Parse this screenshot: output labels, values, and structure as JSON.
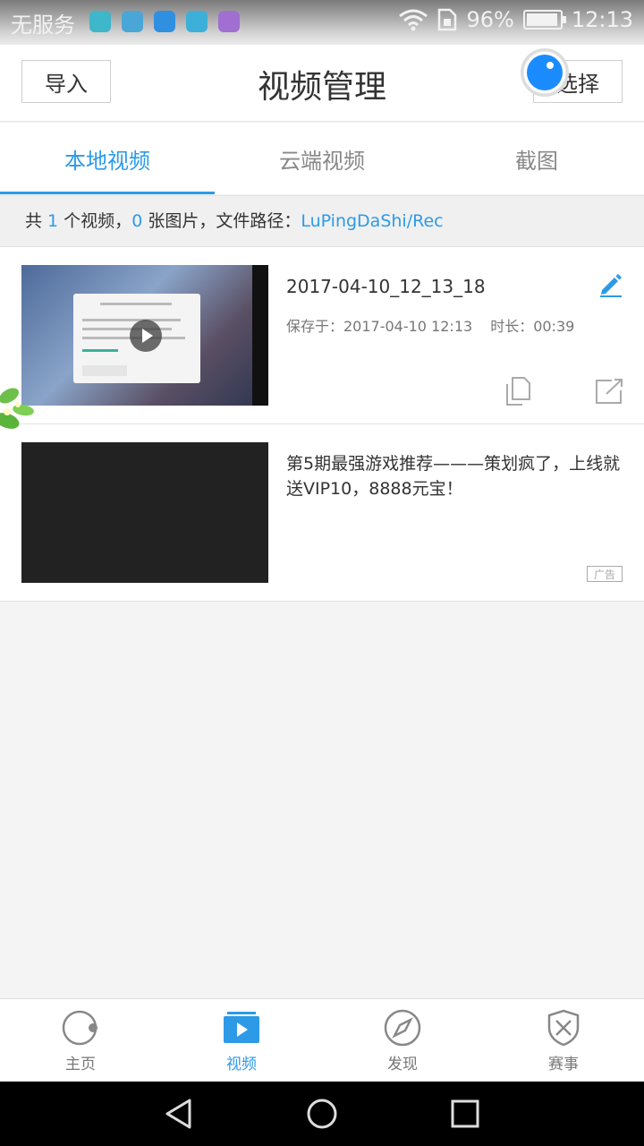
{
  "status_bar": {
    "carrier": "无服务",
    "battery_text": "96%",
    "battery_level": 0.96,
    "time": "12:13",
    "app_icon_colors": [
      "#3db7c9",
      "#4aa6d6",
      "#2f8fe0",
      "#3cb0d8",
      "#a06fd1"
    ]
  },
  "header": {
    "import_label": "导入",
    "title": "视频管理",
    "select_label": "选择"
  },
  "tabs": [
    {
      "label": "本地视频",
      "active": true
    },
    {
      "label": "云端视频",
      "active": false
    },
    {
      "label": "截图",
      "active": false
    }
  ],
  "info": {
    "prefix": "共 ",
    "video_count": "1",
    "mid1": " 个视频，",
    "image_count": "0",
    "mid2": " 张图片，文件路径：",
    "path": "LuPingDaShi/Rec"
  },
  "videos": [
    {
      "title": "2017-04-10_12_13_18",
      "saved_label": "保存于：2017-04-10 12:13",
      "duration_label": "时长：00:39"
    }
  ],
  "ad": {
    "title": "第5期最强游戏推荐———策划疯了，上线就送VIP10，8888元宝！",
    "badge": "广告"
  },
  "bottom_nav": [
    {
      "label": "主页",
      "icon": "record-icon",
      "active": false
    },
    {
      "label": "视频",
      "icon": "video-play-icon",
      "active": true
    },
    {
      "label": "发现",
      "icon": "compass-icon",
      "active": false
    },
    {
      "label": "赛事",
      "icon": "shield-swords-icon",
      "active": false
    }
  ],
  "colors": {
    "accent": "#2d9ae8",
    "text": "#333333",
    "muted": "#888888"
  }
}
